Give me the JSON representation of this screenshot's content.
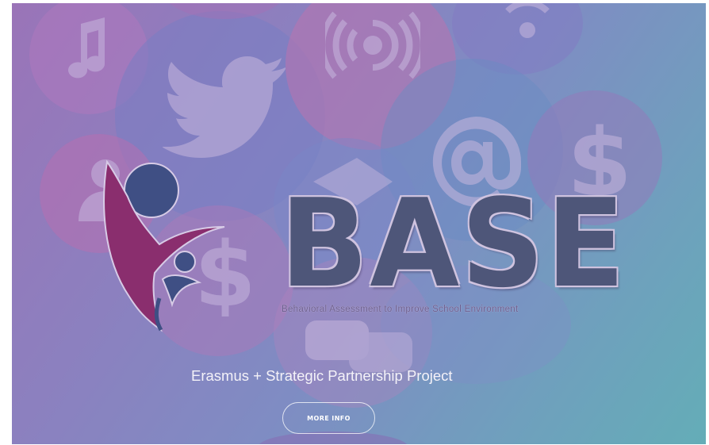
{
  "hero": {
    "brand_title": "BASE",
    "brand_tagline": "Behavioral Assessment to Improve School Environment",
    "subtitle": "Erasmus + Strategic Partnership Project",
    "more_info_label": "MORE INFO"
  },
  "background_icons": [
    "music-note-icon",
    "twitter-bird-icon",
    "broadcast-icon",
    "wifi-icon",
    "at-sign-icon",
    "dollar-icon",
    "users-icon",
    "envelope-icon",
    "chat-bubble-icon"
  ],
  "colors": {
    "gradient_start": "#9a74b8",
    "gradient_end": "#64adb7",
    "brand_text": "#4e5679",
    "logo_magenta": "#8a2e6e",
    "logo_navy": "#3f4f84"
  }
}
